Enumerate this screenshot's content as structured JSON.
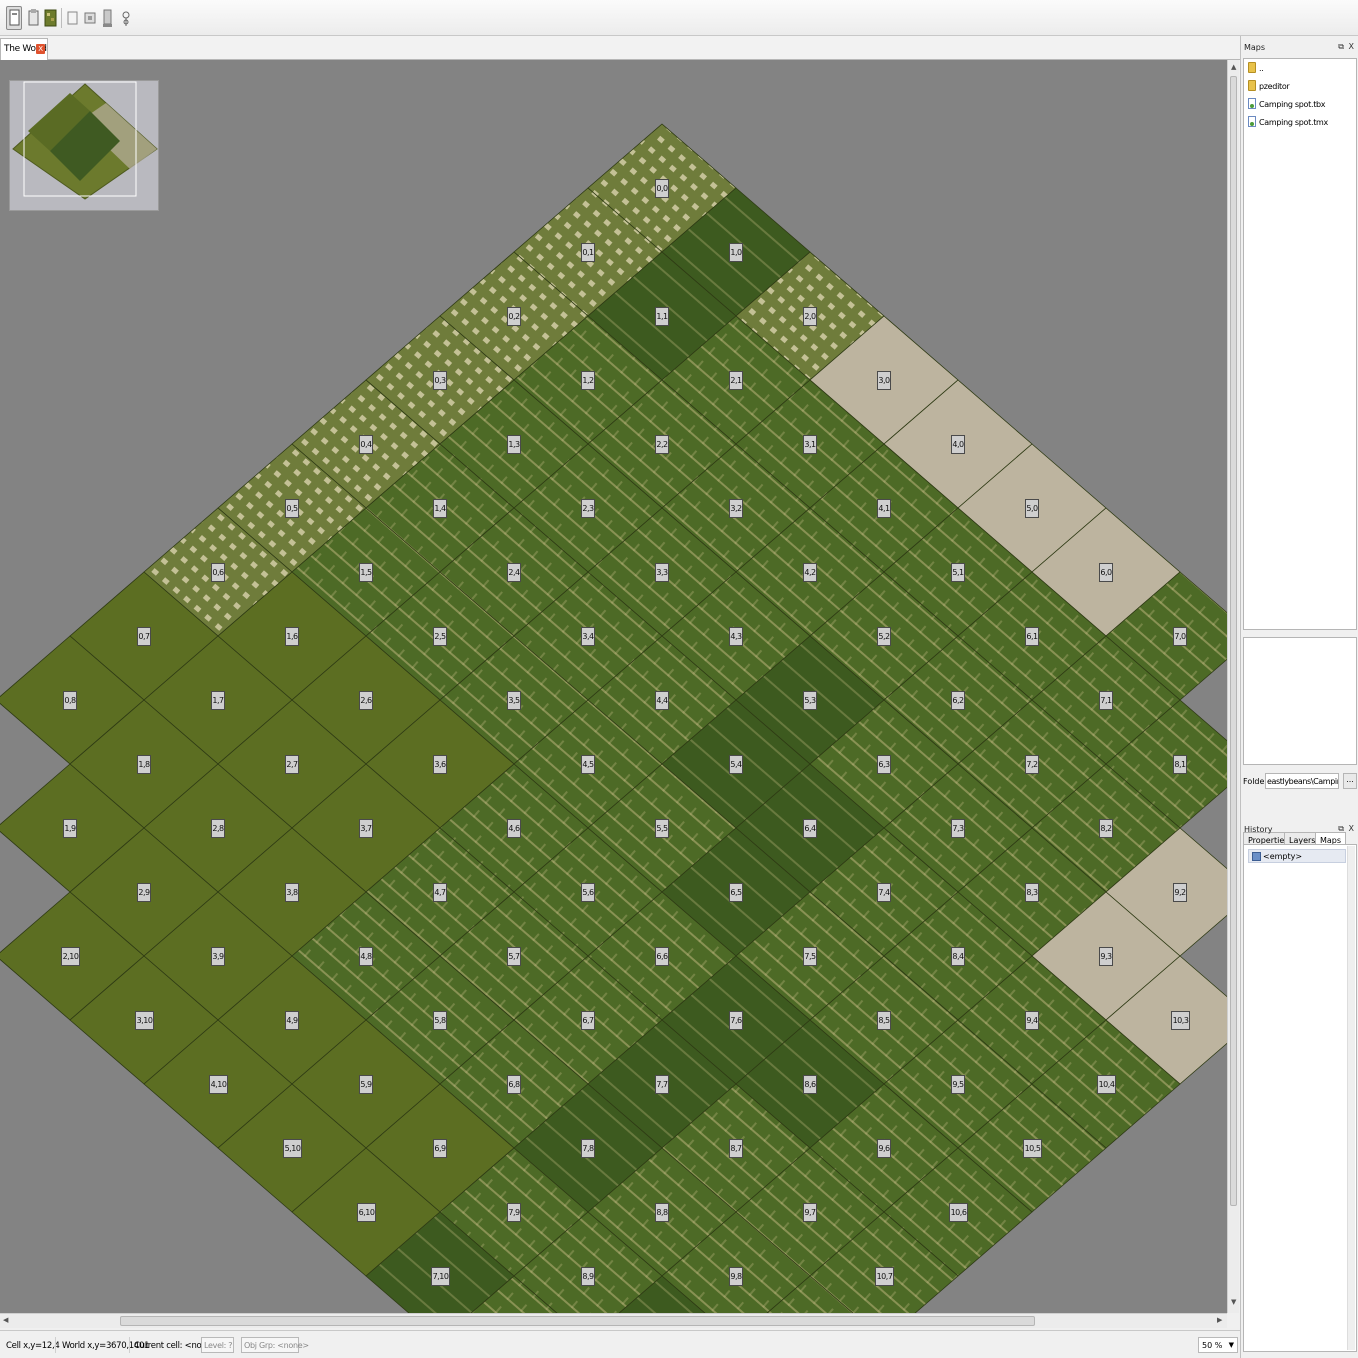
{
  "toolbar": {
    "tools": [
      "select-tool-icon",
      "paste-tool-icon",
      "map-tool-icon",
      "page-icon",
      "layers-icon",
      "stamp-icon",
      "pin-icon"
    ]
  },
  "tabs": [
    {
      "label": "The World",
      "close": "X"
    }
  ],
  "map": {
    "cells": [
      {
        "label": "0,0",
        "tone": "urban"
      },
      {
        "label": "0,1",
        "tone": "urban"
      },
      {
        "label": "0,2",
        "tone": "urban"
      },
      {
        "label": "0,3",
        "tone": "urban"
      },
      {
        "label": "0,4",
        "tone": "urban"
      },
      {
        "label": "0,5",
        "tone": "urban"
      },
      {
        "label": "0,6",
        "tone": "urban"
      },
      {
        "label": "0,7",
        "tone": "grass"
      },
      {
        "label": "0,8",
        "tone": "grass"
      },
      {
        "label": "1,0",
        "tone": "forest"
      },
      {
        "label": "1,1",
        "tone": "forest"
      },
      {
        "label": "1,2",
        "tone": "suburb"
      },
      {
        "label": "1,3",
        "tone": "suburb"
      },
      {
        "label": "1,4",
        "tone": "suburb"
      },
      {
        "label": "1,5",
        "tone": "suburb"
      },
      {
        "label": "1,6",
        "tone": "grass"
      },
      {
        "label": "1,7",
        "tone": "grass"
      },
      {
        "label": "1,8",
        "tone": "grass"
      },
      {
        "label": "1,9",
        "tone": "grass"
      },
      {
        "label": "2,0",
        "tone": "urban"
      },
      {
        "label": "2,1",
        "tone": "suburb"
      },
      {
        "label": "2,2",
        "tone": "suburb"
      },
      {
        "label": "2,3",
        "tone": "suburb"
      },
      {
        "label": "2,4",
        "tone": "suburb"
      },
      {
        "label": "2,5",
        "tone": "suburb"
      },
      {
        "label": "2,6",
        "tone": "grass"
      },
      {
        "label": "2,7",
        "tone": "grass"
      },
      {
        "label": "2,8",
        "tone": "grass"
      },
      {
        "label": "2,9",
        "tone": "grass"
      },
      {
        "label": "2,10",
        "tone": "grass"
      },
      {
        "label": "3,0",
        "tone": "sand"
      },
      {
        "label": "3,1",
        "tone": "suburb"
      },
      {
        "label": "3,2",
        "tone": "suburb"
      },
      {
        "label": "3,3",
        "tone": "suburb"
      },
      {
        "label": "3,4",
        "tone": "suburb"
      },
      {
        "label": "3,5",
        "tone": "suburb"
      },
      {
        "label": "3,6",
        "tone": "grass"
      },
      {
        "label": "3,7",
        "tone": "grass"
      },
      {
        "label": "3,8",
        "tone": "grass"
      },
      {
        "label": "3,9",
        "tone": "grass"
      },
      {
        "label": "3,10",
        "tone": "grass"
      },
      {
        "label": "4,0",
        "tone": "sand"
      },
      {
        "label": "4,1",
        "tone": "suburb"
      },
      {
        "label": "4,2",
        "tone": "suburb"
      },
      {
        "label": "4,3",
        "tone": "suburb"
      },
      {
        "label": "4,4",
        "tone": "suburb"
      },
      {
        "label": "4,5",
        "tone": "suburb"
      },
      {
        "label": "4,6",
        "tone": "suburb"
      },
      {
        "label": "4,7",
        "tone": "suburb"
      },
      {
        "label": "4,8",
        "tone": "suburb"
      },
      {
        "label": "4,9",
        "tone": "grass"
      },
      {
        "label": "4,10",
        "tone": "grass"
      },
      {
        "label": "5,0",
        "tone": "sand"
      },
      {
        "label": "5,1",
        "tone": "suburb"
      },
      {
        "label": "5,2",
        "tone": "suburb"
      },
      {
        "label": "5,3",
        "tone": "forest"
      },
      {
        "label": "5,4",
        "tone": "forest"
      },
      {
        "label": "5,5",
        "tone": "suburb"
      },
      {
        "label": "5,6",
        "tone": "suburb"
      },
      {
        "label": "5,7",
        "tone": "suburb"
      },
      {
        "label": "5,8",
        "tone": "suburb"
      },
      {
        "label": "5,9",
        "tone": "grass"
      },
      {
        "label": "5,10",
        "tone": "grass"
      },
      {
        "label": "6,0",
        "tone": "sand"
      },
      {
        "label": "6,1",
        "tone": "suburb"
      },
      {
        "label": "6,2",
        "tone": "suburb"
      },
      {
        "label": "6,3",
        "tone": "suburb"
      },
      {
        "label": "6,4",
        "tone": "forest"
      },
      {
        "label": "6,5",
        "tone": "forest"
      },
      {
        "label": "6,6",
        "tone": "suburb"
      },
      {
        "label": "6,7",
        "tone": "suburb"
      },
      {
        "label": "6,8",
        "tone": "suburb"
      },
      {
        "label": "6,9",
        "tone": "grass"
      },
      {
        "label": "6,10",
        "tone": "grass"
      },
      {
        "label": "7,0",
        "tone": "suburb"
      },
      {
        "label": "7,1",
        "tone": "suburb"
      },
      {
        "label": "7,2",
        "tone": "suburb"
      },
      {
        "label": "7,3",
        "tone": "suburb"
      },
      {
        "label": "7,4",
        "tone": "suburb"
      },
      {
        "label": "7,5",
        "tone": "suburb"
      },
      {
        "label": "7,6",
        "tone": "forest"
      },
      {
        "label": "7,7",
        "tone": "forest"
      },
      {
        "label": "7,8",
        "tone": "forest"
      },
      {
        "label": "7,9",
        "tone": "suburb"
      },
      {
        "label": "7,10",
        "tone": "forest"
      },
      {
        "label": "8,1",
        "tone": "suburb"
      },
      {
        "label": "8,2",
        "tone": "suburb"
      },
      {
        "label": "8,3",
        "tone": "suburb"
      },
      {
        "label": "8,4",
        "tone": "suburb"
      },
      {
        "label": "8,5",
        "tone": "suburb"
      },
      {
        "label": "8,6",
        "tone": "forest"
      },
      {
        "label": "8,7",
        "tone": "suburb"
      },
      {
        "label": "8,8",
        "tone": "suburb"
      },
      {
        "label": "8,9",
        "tone": "suburb"
      },
      {
        "label": "8,10",
        "tone": "suburb"
      },
      {
        "label": "9,2",
        "tone": "sand"
      },
      {
        "label": "9,3",
        "tone": "sand"
      },
      {
        "label": "9,4",
        "tone": "suburb"
      },
      {
        "label": "9,5",
        "tone": "suburb"
      },
      {
        "label": "9,6",
        "tone": "suburb"
      },
      {
        "label": "9,7",
        "tone": "suburb"
      },
      {
        "label": "9,8",
        "tone": "suburb"
      },
      {
        "label": "9,9",
        "tone": "forest"
      },
      {
        "label": "10,3",
        "tone": "sand"
      },
      {
        "label": "10,4",
        "tone": "suburb"
      },
      {
        "label": "10,5",
        "tone": "suburb"
      },
      {
        "label": "10,6",
        "tone": "suburb"
      },
      {
        "label": "10,7",
        "tone": "suburb"
      },
      {
        "label": "10,8",
        "tone": "suburb"
      }
    ],
    "colors": {
      "urban": "#6f7c3b",
      "forest": "#3d5a1f",
      "suburb": "#4d6a26",
      "grass": "#5c6e22",
      "sand": "#bdb49f",
      "road": "#b9b37a",
      "background": "#838383"
    }
  },
  "status": {
    "cell": "Cell x,y=12,4",
    "world": "World x,y=3670,1401",
    "current_cell": "Current cell: <none>",
    "level": "Level: ?",
    "obj_grp": "Obj Grp: <none>",
    "zoom": "50 %"
  },
  "maps_panel": {
    "title": "Maps",
    "files": [
      {
        "name": "..",
        "type": "folder"
      },
      {
        "name": "pzeditor",
        "type": "folder"
      },
      {
        "name": "Camping spot.tbx",
        "type": "file"
      },
      {
        "name": "Camping spot.tmx",
        "type": "file"
      }
    ],
    "folder_label": "Folder:",
    "folder_value": "eastlybeans\\Campingspot",
    "browse_label": "...",
    "tabs": [
      "Properties",
      "Layers",
      "Maps"
    ]
  },
  "history_panel": {
    "title": "History",
    "items": [
      "<empty>"
    ]
  },
  "dock_buttons": "⧉ X"
}
